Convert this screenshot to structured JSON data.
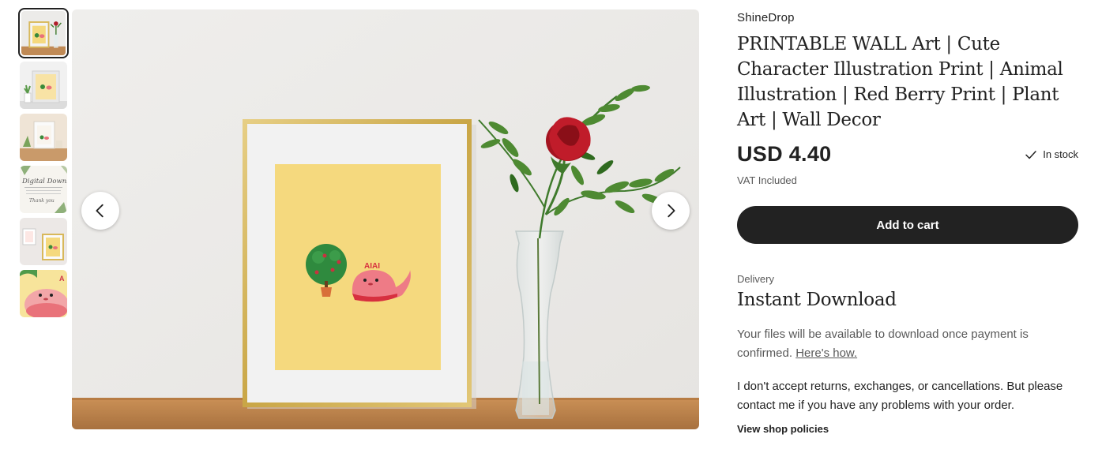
{
  "shop": {
    "name": "ShineDrop"
  },
  "listing": {
    "title": "PRINTABLE WALL Art | Cute Character Illustration Print | Animal Illustration | Red Berry Print | Plant Art | Wall Decor",
    "price": "USD 4.40",
    "stock": "In stock",
    "vat": "VAT Included",
    "add_to_cart": "Add to cart"
  },
  "art": {
    "character_label": "AIAI"
  },
  "delivery": {
    "label": "Delivery",
    "title": "Instant Download",
    "description": "Your files will be available to download once payment is confirmed.",
    "link": "Here's how.",
    "returns": "I don't accept returns, exchanges, or cancellations. But please contact me if you have any problems with your order.",
    "policies_link": "View shop policies"
  },
  "thumb_text": {
    "line1": "Digital Download",
    "line2": "Thank you"
  },
  "gallery": {
    "thumbnails": [
      {
        "name": "framed-print-vase"
      },
      {
        "name": "framed-print-plant"
      },
      {
        "name": "framed-print-shelf"
      },
      {
        "name": "digital-download-card"
      },
      {
        "name": "framed-print-gallery"
      },
      {
        "name": "character-closeup"
      }
    ],
    "active_index": 0
  },
  "colors": {
    "text": "#222222",
    "muted": "#595959",
    "button": "#222222",
    "print_yellow": "#f5d97e",
    "frame_gold": "#d8b85a",
    "wall": "#ecebe9",
    "table": "#c08a55"
  }
}
